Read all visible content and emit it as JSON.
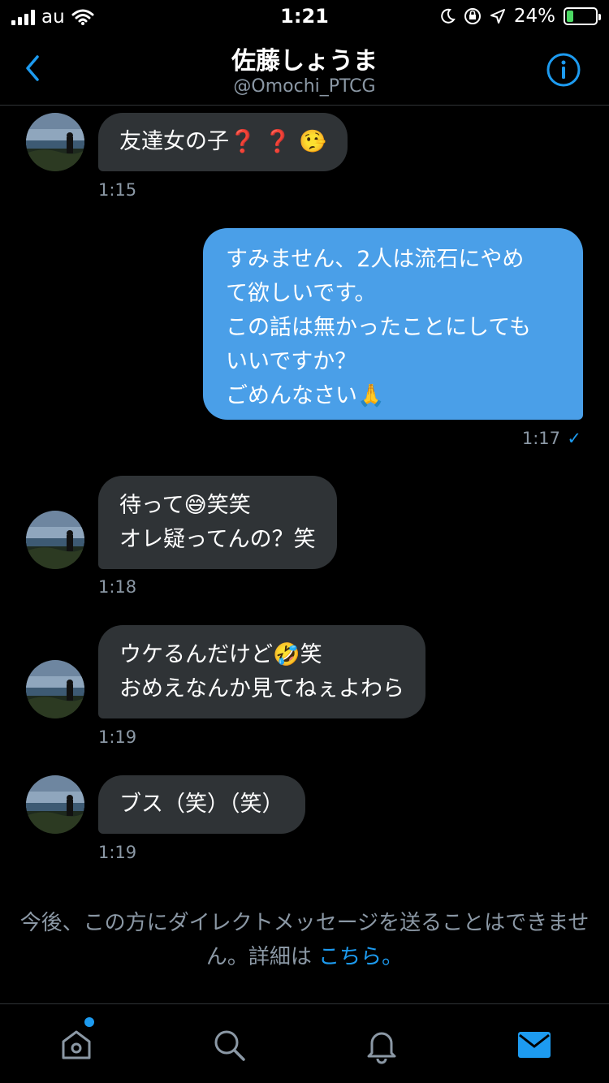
{
  "status_bar": {
    "carrier": "au",
    "time": "1:21",
    "battery": "24%",
    "battery_level": 0.24
  },
  "header": {
    "name": "佐藤しょうま",
    "handle": "@Omochi_PTCG"
  },
  "messages": [
    {
      "direction": "in",
      "lines": [
        "友達女の子"
      ],
      "emoji_after": "❓ ❓ 🤥",
      "time": "1:15"
    },
    {
      "direction": "out",
      "lines": [
        "すみません、2人は流石にやめ",
        "て欲しいです。",
        "この話は無かったことにしても",
        "いいですか？",
        "ごめんなさい🙏"
      ],
      "time": "1:17",
      "read_mark": "✓"
    },
    {
      "direction": "in",
      "lines": [
        "待って😅笑笑",
        "オレ疑ってんの？笑"
      ],
      "time": "1:18"
    },
    {
      "direction": "in",
      "lines": [
        "ウケるんだけど🤣笑",
        "おめえなんか見てねぇよわら"
      ],
      "time": "1:19"
    },
    {
      "direction": "in",
      "lines": [
        "ブス（笑）（笑）"
      ],
      "time": "1:19"
    }
  ],
  "notice": {
    "text": "今後、この方にダイレクトメッセージを送ることはできません。詳細は",
    "link": "こちら。"
  },
  "colors": {
    "accent": "#1d9bf0",
    "incoming_bubble": "#2f3336",
    "outgoing_bubble": "#4a9fe8",
    "muted": "#8b98a5"
  },
  "tabs": [
    "home-icon",
    "search-icon",
    "notifications-icon",
    "messages-icon"
  ]
}
